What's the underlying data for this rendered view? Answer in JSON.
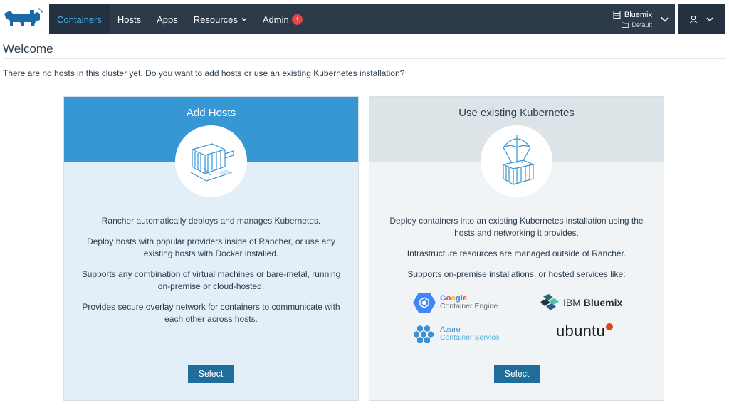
{
  "nav": {
    "items": [
      {
        "label": "Containers",
        "active": true
      },
      {
        "label": "Hosts"
      },
      {
        "label": "Apps"
      },
      {
        "label": "Resources",
        "dropdown": true
      },
      {
        "label": "Admin",
        "badge": "!"
      }
    ],
    "environment": {
      "name": "Bluemix",
      "sub": "Default"
    }
  },
  "page": {
    "title": "Welcome",
    "intro": "There are no hosts in this cluster yet. Do you want to add hosts or use an existing Kubernetes installation?"
  },
  "cards": {
    "add_hosts": {
      "title": "Add Hosts",
      "paragraphs": [
        "Rancher automatically deploys and manages Kubernetes.",
        "Deploy hosts with popular providers inside of Rancher, or use any existing hosts with Docker installed.",
        "Supports any combination of virtual machines or bare-metal, running on-premise or cloud-hosted.",
        "Provides secure overlay network for containers to communicate with each other across hosts."
      ],
      "button": "Select"
    },
    "existing_k8s": {
      "title": "Use existing Kubernetes",
      "paragraphs": [
        "Deploy containers into an existing Kubernetes installation using the hosts and networking it provides.",
        "Infrastructure resources are managed outside of Rancher.",
        "Supports on-premise installations, or hosted services like:"
      ],
      "providers": {
        "gke": {
          "brand": "Google",
          "name": "Container Engine"
        },
        "ibm": {
          "brand": "IBM",
          "name": "Bluemix"
        },
        "azure": {
          "brand": "Azure",
          "name": "Container Service"
        },
        "ubuntu": {
          "name": "ubuntu"
        }
      },
      "button": "Select"
    }
  },
  "colors": {
    "nav_bg": "#2c3a49",
    "nav_active": "#3fb5e6",
    "add_hosts_header": "#3796d4",
    "add_hosts_body": "#e2eef8",
    "existing_header": "#dde4e8",
    "existing_body": "#f1f4f6",
    "button": "#1f6d9c",
    "badge": "#e64646"
  }
}
